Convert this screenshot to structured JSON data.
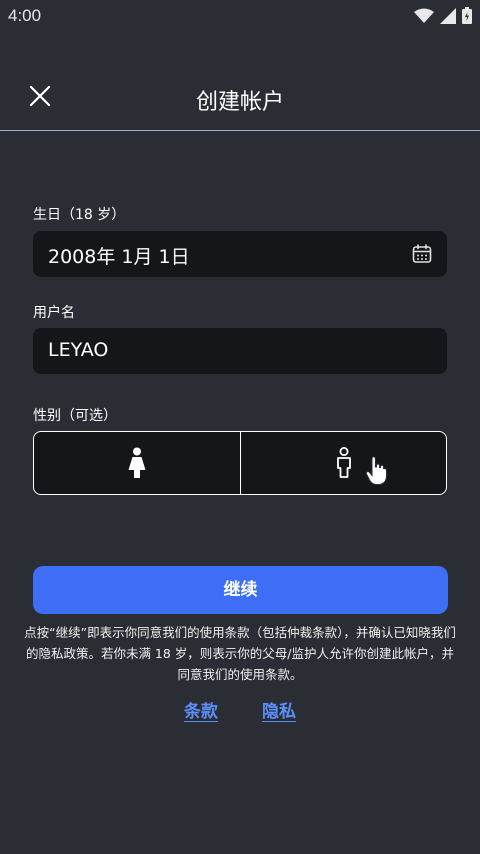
{
  "status_bar": {
    "time": "4:00",
    "icons": [
      "wifi-icon",
      "signal-icon",
      "battery-icon"
    ]
  },
  "header": {
    "close_icon": "close-icon",
    "title": "创建帐户"
  },
  "birthday": {
    "label": "生日（18 岁）",
    "value": "2008年 1月 1日",
    "icon": "calendar-icon"
  },
  "username": {
    "label": "用户名",
    "value": "LEYAO"
  },
  "gender": {
    "label": "性别（可选）",
    "options": [
      {
        "icon": "female-icon"
      },
      {
        "icon": "male-icon"
      }
    ]
  },
  "continue_button": {
    "label": "继续"
  },
  "terms_notice": {
    "text": "点按“继续”即表示你同意我们的使用条款（包括仲裁条款），并确认已知晓我们的隐私政策。若你未满 18 岁，则表示你的父母/监护人允许你创建此帐户，并同意我们的使用条款。"
  },
  "links": {
    "terms": "条款",
    "privacy": "隐私"
  },
  "colors": {
    "background": "#2b2d34",
    "field": "#15161a",
    "accent": "#3d6ef5",
    "link": "#5b8ef6"
  }
}
